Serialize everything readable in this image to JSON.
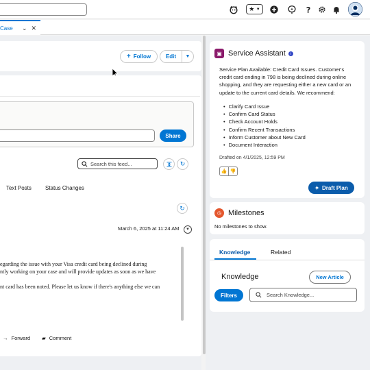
{
  "header": {
    "icons": [
      "search-box",
      "astro-icon",
      "favorites-star-icon",
      "favorites-dropdown-icon",
      "add-icon",
      "trailhead-icon",
      "help-icon",
      "setup-gear-icon",
      "notifications-bell-icon",
      "user-avatar"
    ]
  },
  "tabs": {
    "active_label": "Case"
  },
  "record": {
    "follow_label": "Follow",
    "edit_label": "Edit"
  },
  "publisher": {
    "share_label": "Share"
  },
  "feed": {
    "search_placeholder": "Search this feed...",
    "filter_tabs": [
      "Text Posts",
      "Status Changes"
    ],
    "post_date": "March 6, 2025 at 11:24 AM",
    "post_lines": [
      "egarding the issue with your Visa credit card being declined during",
      "ntly working on your case and will provide updates as soon as we have",
      "",
      "nt card has been noted. Please let us know if there's anything else we can"
    ],
    "actions": {
      "forward": "Forward",
      "comment": "Comment"
    }
  },
  "service_assistant": {
    "title": "Service Assistant",
    "body": "Service Plan Available: Credit Card Issues. Customer's credit card ending in 798 is being declined during online shopping, and they are requesting either a new card or an update to the current card details. We recommend:",
    "steps": [
      "Clarify Card Issue",
      "Confirm Card Status",
      "Check Account Holds",
      "Confirm Recent Transactions",
      "Inform Customer about New Card",
      "Document Interaction"
    ],
    "drafted": "Drafted on 4/1/2025, 12:59 PM",
    "draft_button": "Draft Plan"
  },
  "milestones": {
    "title": "Milestones",
    "empty_text": "No milestones to show."
  },
  "knowledge": {
    "tabs": [
      "Knowledge",
      "Related"
    ],
    "heading": "Knowledge",
    "new_article": "New Article",
    "filters": "Filters",
    "search_placeholder": "Search Knowledge..."
  },
  "colors": {
    "brand_blue": "#0176d3",
    "dark_blue": "#0b5cab",
    "assistant_icon": "#8b1a6b",
    "milestone_icon": "#e4572e"
  }
}
